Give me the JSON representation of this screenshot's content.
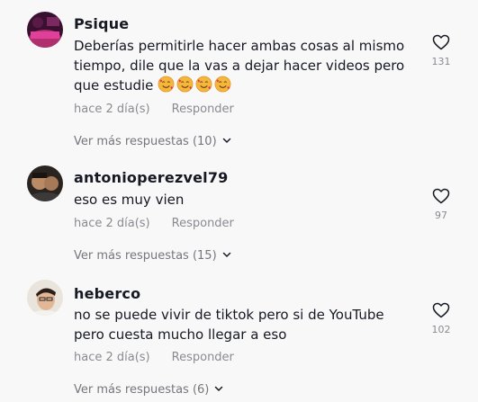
{
  "comments": [
    {
      "username": "Psique",
      "text": "Deberías permitirle hacer ambas cosas al mismo tiempo, dile que la vas a dejar hacer videos pero que estudie",
      "emojis": [
        "smiling-face-with-hearts",
        "smiling-face-with-hearts",
        "smiling-face-with-hearts",
        "smiling-face-with-hearts"
      ],
      "time": "hace 2 día(s)",
      "reply_label": "Responder",
      "view_replies": "Ver más respuestas (10)",
      "likes": "131"
    },
    {
      "username": "antonioperezvel79",
      "text": "eso es muy vien",
      "time": "hace 2 día(s)",
      "reply_label": "Responder",
      "view_replies": "Ver más respuestas (15)",
      "likes": "97"
    },
    {
      "username": "heberco",
      "text": "no se puede vivir de tiktok pero si de YouTube pero cuesta mucho llegar a eso",
      "time": "hace 2 día(s)",
      "reply_label": "Responder",
      "view_replies": "Ver más respuestas (6)",
      "likes": "102"
    }
  ],
  "icons": {
    "like": "heart-outline-icon",
    "expand": "chevron-down-icon"
  },
  "colors": {
    "background": "#f8f8f8",
    "text": "#161823",
    "muted": "#8a8b91"
  }
}
